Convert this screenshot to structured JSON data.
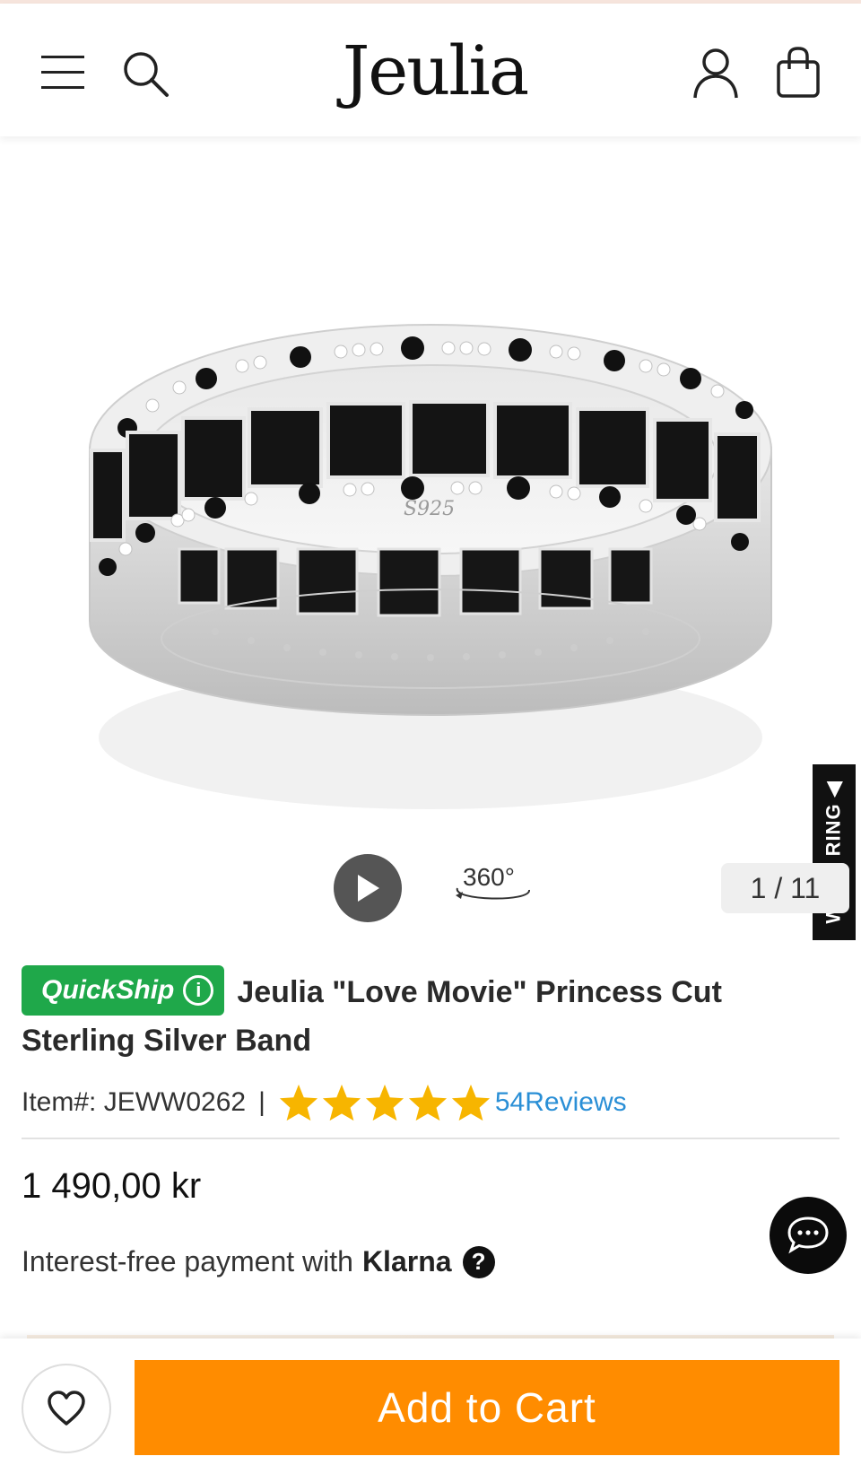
{
  "header": {
    "logo_text": "Jeulia",
    "menu_icon": "hamburger-menu-icon",
    "search_icon": "search-icon",
    "account_icon": "user-icon",
    "cart_icon": "shopping-bag-icon"
  },
  "gallery": {
    "image_counter": "1 / 11",
    "view360_label": "360°",
    "side_tab_label": "WIN A RING ◀",
    "hallmark": "S925"
  },
  "product": {
    "badge_label": "QuickShip",
    "title": "Jeulia \"Love Movie\" Princess Cut Sterling Silver Band",
    "item_label": "Item#: JEWW0262",
    "separator": "|",
    "rating": 5,
    "rating_max": 5,
    "reviews_text": "54Reviews",
    "price": "1 490,00 kr",
    "klarna_text": "Interest-free payment with",
    "klarna_brand": "Klarna",
    "klarna_help": "?"
  },
  "actions": {
    "add_to_cart_label": "Add to Cart"
  },
  "colors": {
    "accent_orange": "#ff8c00",
    "quickship_green": "#1fa84a",
    "star_yellow": "#f7b500",
    "link_blue": "#2a8fd6"
  }
}
